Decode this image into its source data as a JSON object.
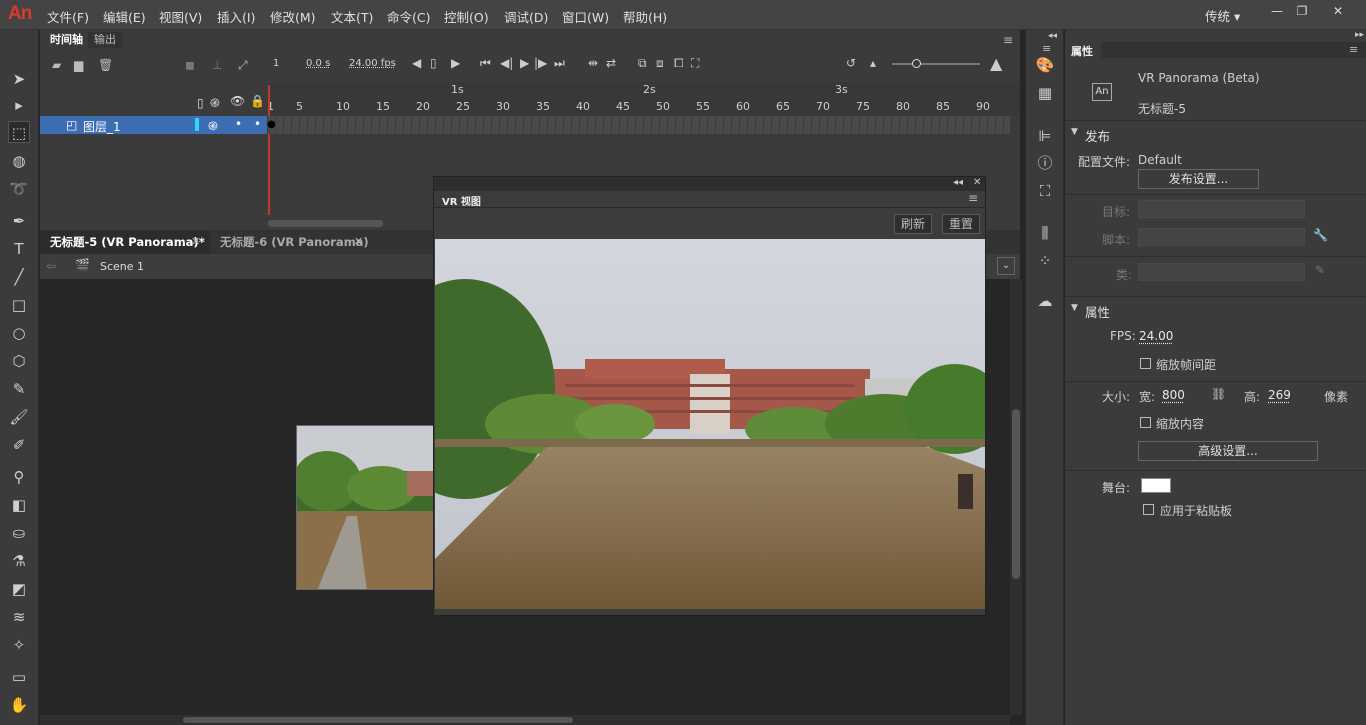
{
  "app": {
    "logo": "An"
  },
  "menu": [
    "文件(F)",
    "编辑(E)",
    "视图(V)",
    "插入(I)",
    "修改(M)",
    "文本(T)",
    "命令(C)",
    "控制(O)",
    "调试(D)",
    "窗口(W)",
    "帮助(H)"
  ],
  "workspace": "传统",
  "timeline": {
    "tabs": [
      "时间轴",
      "输出"
    ],
    "frame": "1",
    "time": "0.0 s",
    "fps": "24.00 fps",
    "ruler_seconds": [
      "1s",
      "2s",
      "3s"
    ],
    "ruler_frames": [
      "1",
      "5",
      "10",
      "15",
      "20",
      "25",
      "30",
      "35",
      "40",
      "45",
      "50",
      "55",
      "60",
      "65",
      "70",
      "75",
      "80",
      "85",
      "90"
    ],
    "layer_name": "图层_1"
  },
  "documents": {
    "tabs": [
      "无标题-5 (VR Panorama)*",
      "无标题-6 (VR Panorama)"
    ],
    "scene": "Scene 1"
  },
  "vr_panel": {
    "title": "VR 视图",
    "refresh": "刷新",
    "reset": "重置"
  },
  "properties": {
    "tab": "属性",
    "doc_type": "VR Panorama (Beta)",
    "doc_name": "无标题-5",
    "doc_icon": "An",
    "publish_section": "发布",
    "profile_label": "配置文件:",
    "profile_value": "Default",
    "publish_settings_btn": "发布设置...",
    "target_label": "目标:",
    "script_label": "脚本:",
    "class_label": "类:",
    "props_section": "属性",
    "fps_label": "FPS:",
    "fps_value": "24.00",
    "scale_spacing": "缩放帧间距",
    "size_label": "大小:",
    "width_label": "宽:",
    "width_value": "800",
    "height_label": "高:",
    "height_value": "269",
    "unit": "像素",
    "scale_content": "缩放内容",
    "advanced_btn": "高级设置...",
    "stage_label": "舞台:",
    "stage_color": "#ffffff",
    "apply_clipboard": "应用于粘贴板"
  }
}
